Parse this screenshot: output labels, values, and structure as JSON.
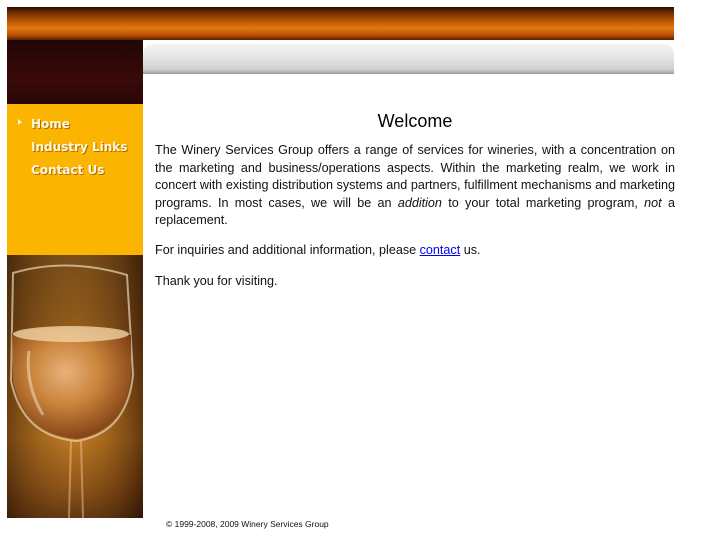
{
  "nav": {
    "items": [
      {
        "label": "Home",
        "active": true
      },
      {
        "label": "Industry Links",
        "active": false
      },
      {
        "label": "Contact Us",
        "active": false
      }
    ]
  },
  "main": {
    "title": "Welcome",
    "p1_a": "The Winery Services Group offers a range of services for wineries, with a concentration on the marketing and business/operations aspects. Within the marketing realm, we work in concert with existing distribution systems and partners, fulfillment mechanisms and marketing programs. In most cases, we will be an ",
    "p1_em1": "addition",
    "p1_b": " to your total marketing program, ",
    "p1_em2": "not",
    "p1_c": " a replacement.",
    "p2_a": "For inquiries and additional information, please ",
    "p2_link": "contact",
    "p2_b": " us.",
    "p3": "Thank you for visiting."
  },
  "footer": {
    "copyright": "© 1999-2008, 2009 Winery Services Group"
  },
  "colors": {
    "nav_background": "#fbb400",
    "header_bar": "#c25a05",
    "link": "#0000ee"
  }
}
